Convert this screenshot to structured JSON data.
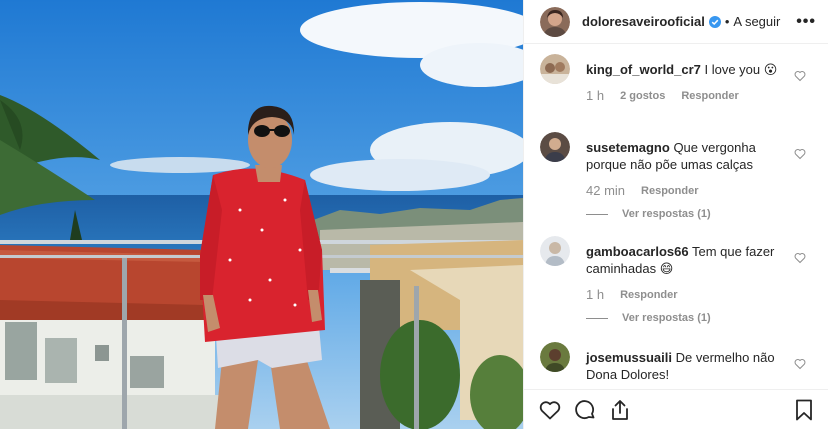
{
  "post": {
    "username": "doloresaveirooficial",
    "follow_label": "A seguir",
    "separator": "•",
    "more_label": "•••"
  },
  "comments": [
    {
      "username": "king_of_world_cr7",
      "text": "I love you 😮",
      "time": "1 h",
      "likes": "2 gostos",
      "reply": "Responder",
      "replies": ""
    },
    {
      "username": "susetemagno",
      "text": "Que vergonha porque não põe umas calças",
      "time": "42 min",
      "likes": "",
      "reply": "Responder",
      "replies": "Ver respostas (1)"
    },
    {
      "username": "gamboacarlos66",
      "text": "Tem que fazer caminhadas 😄",
      "time": "1 h",
      "likes": "",
      "reply": "Responder",
      "replies": "Ver respostas (1)"
    },
    {
      "username": "josemussuaili",
      "text": "De vermelho não Dona Dolores!",
      "time": "",
      "likes": "",
      "reply": "",
      "replies": ""
    }
  ],
  "icons": {
    "like": "heart-icon",
    "comment": "comment-icon",
    "share": "share-icon",
    "save": "bookmark-icon",
    "verified": "verified-badge-icon",
    "more": "more-options-icon"
  },
  "colors": {
    "verified": "#3897f0",
    "muted": "#8e8e8e",
    "text": "#262626",
    "shirt": "#d9232e",
    "sky": "#2f86d6"
  }
}
